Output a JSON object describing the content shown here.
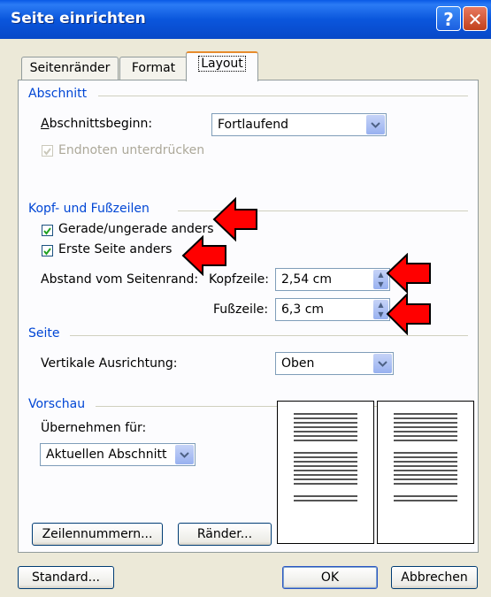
{
  "window": {
    "title": "Seite einrichten",
    "help_glyph": "?",
    "close_glyph": "✕"
  },
  "tabs": [
    {
      "label": "Seitenränder",
      "active": false
    },
    {
      "label": "Format",
      "active": false
    },
    {
      "label": "Layout",
      "active": true
    }
  ],
  "abschnitt": {
    "group_label": "Abschnitt",
    "beginn_label": "Abschnittsbeginn:",
    "beginn_value": "Fortlaufend",
    "endnoten_label": "Endnoten unterdrücken",
    "endnoten_checked": true,
    "endnoten_disabled": true
  },
  "kopf_fuss": {
    "group_label": "Kopf- und Fußzeilen",
    "gerade_label": "Gerade/ungerade anders",
    "gerade_checked": true,
    "erste_label": "Erste Seite anders",
    "erste_checked": true,
    "abstand_label": "Abstand vom Seitenrand:",
    "kopfzeile_label": "Kopfzeile:",
    "kopfzeile_value": "2,54 cm",
    "fusszeile_label": "Fußzeile:",
    "fusszeile_value": "6,3 cm"
  },
  "seite": {
    "group_label": "Seite",
    "ausrichtung_label": "Vertikale Ausrichtung:",
    "ausrichtung_value": "Oben"
  },
  "vorschau": {
    "group_label": "Vorschau",
    "uebernehmen_label": "Übernehmen für:",
    "uebernehmen_value": "Aktuellen Abschnitt"
  },
  "panel_buttons": {
    "zeilennummern": "Zeilennummern...",
    "raender": "Ränder..."
  },
  "footer_buttons": {
    "standard": "Standard...",
    "ok": "OK",
    "abbrechen": "Abbrechen"
  },
  "colors": {
    "title_bar": "#0A56DC",
    "group_label": "#0046D5",
    "annotation_arrow": "#FF0000",
    "dialog_bg": "#ECE9D8"
  }
}
